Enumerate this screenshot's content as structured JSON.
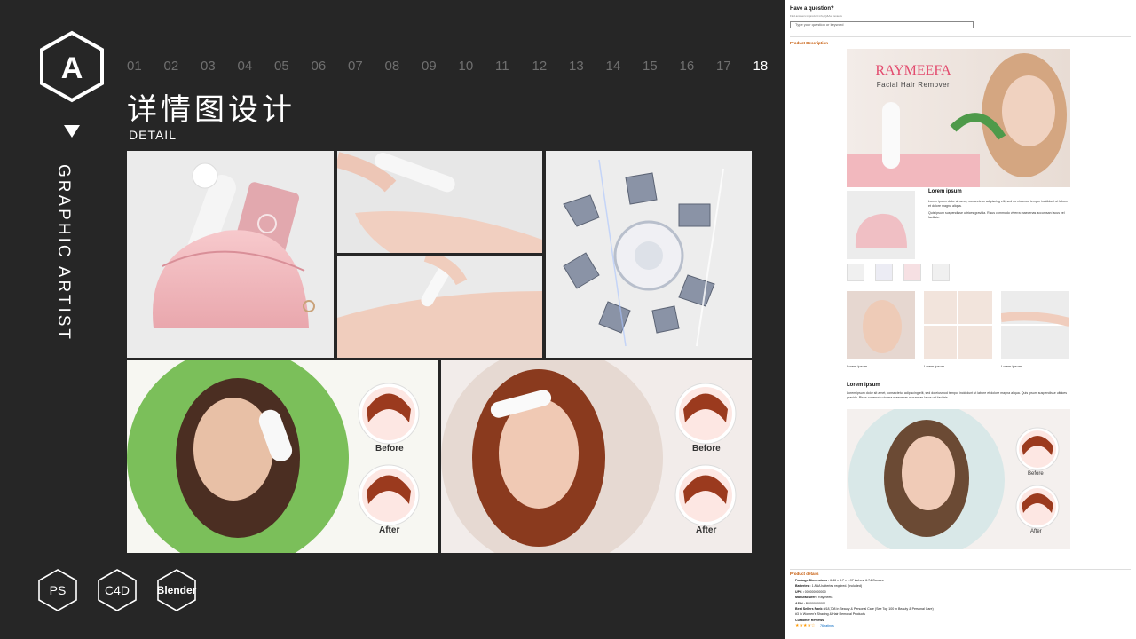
{
  "brand_logo_letter": "A",
  "vertical_text": "GRAPHIC ARTIST",
  "pages": [
    "01",
    "02",
    "03",
    "04",
    "05",
    "06",
    "07",
    "08",
    "09",
    "10",
    "11",
    "12",
    "13",
    "14",
    "15",
    "16",
    "17",
    "18"
  ],
  "active_page": "18",
  "title": "详情图设计",
  "subtitle": "DETAIL",
  "tiles": {
    "before": "Before",
    "after": "After"
  },
  "tools": [
    "PS",
    "C4D",
    "Blender"
  ],
  "colors": {
    "bg": "#262626",
    "accent": "#e34b6e",
    "pink": "#f2b8be",
    "link": "#c45500"
  },
  "product_page": {
    "question_title": "Have a question?",
    "question_hint": "Find answers in product info, Q&As, reviews",
    "question_placeholder": "Type your question or keyword",
    "desc_heading": "Product Description",
    "hero_brand": "RAYMEEFA",
    "hero_tagline": "Facial Hair Remover",
    "lorem_heading": "Lorem ipsum",
    "lorem_p1": "Lorem ipsum dolor sit amet, consectetur adipiscing elit, sed do eiusmod tempor incididunt ut labore et dolore magna aliqua.",
    "lorem_p2": "Quis ipsum suspendisse ultrices gravida. Risus commodo viverra maecenas accumsan lacus vel facilisis.",
    "caption": "Lorem ipsum",
    "lorem2_heading": "Lorem ipsum",
    "lorem2_p": "Lorem ipsum dolor sit amet, consectetur adipiscing elit, sed do eiusmod tempor incididunt ut labore et dolore magna aliqua. Quis ipsum suspendisse ultrices gravida. Risus commodo viverra maecenas accumsan lacus vel facilisis.",
    "before": "Before",
    "after": "After",
    "details_heading": "Product details",
    "details": [
      {
        "k": "Package Dimensions :",
        "v": "6.46 x 3.7 x 1.97 inches; 6.74 Ounces"
      },
      {
        "k": "Batteries :",
        "v": "1 AAA batteries required. (included)"
      },
      {
        "k": "UPC :",
        "v": "000000000000"
      },
      {
        "k": "Manufacturer :",
        "v": "Raymeefa"
      },
      {
        "k": "ASIN :",
        "v": "B0000000000"
      },
      {
        "k": "Best Sellers Rank:",
        "v": "#18,708 in Beauty & Personal Care (See Top 100 in Beauty & Personal Care)"
      },
      {
        "k": "",
        "v": "#3 in Women's Shaving & Hair Removal Products"
      },
      {
        "k": "Customer Reviews:",
        "v": ""
      }
    ],
    "ratings": "76 ratings"
  }
}
